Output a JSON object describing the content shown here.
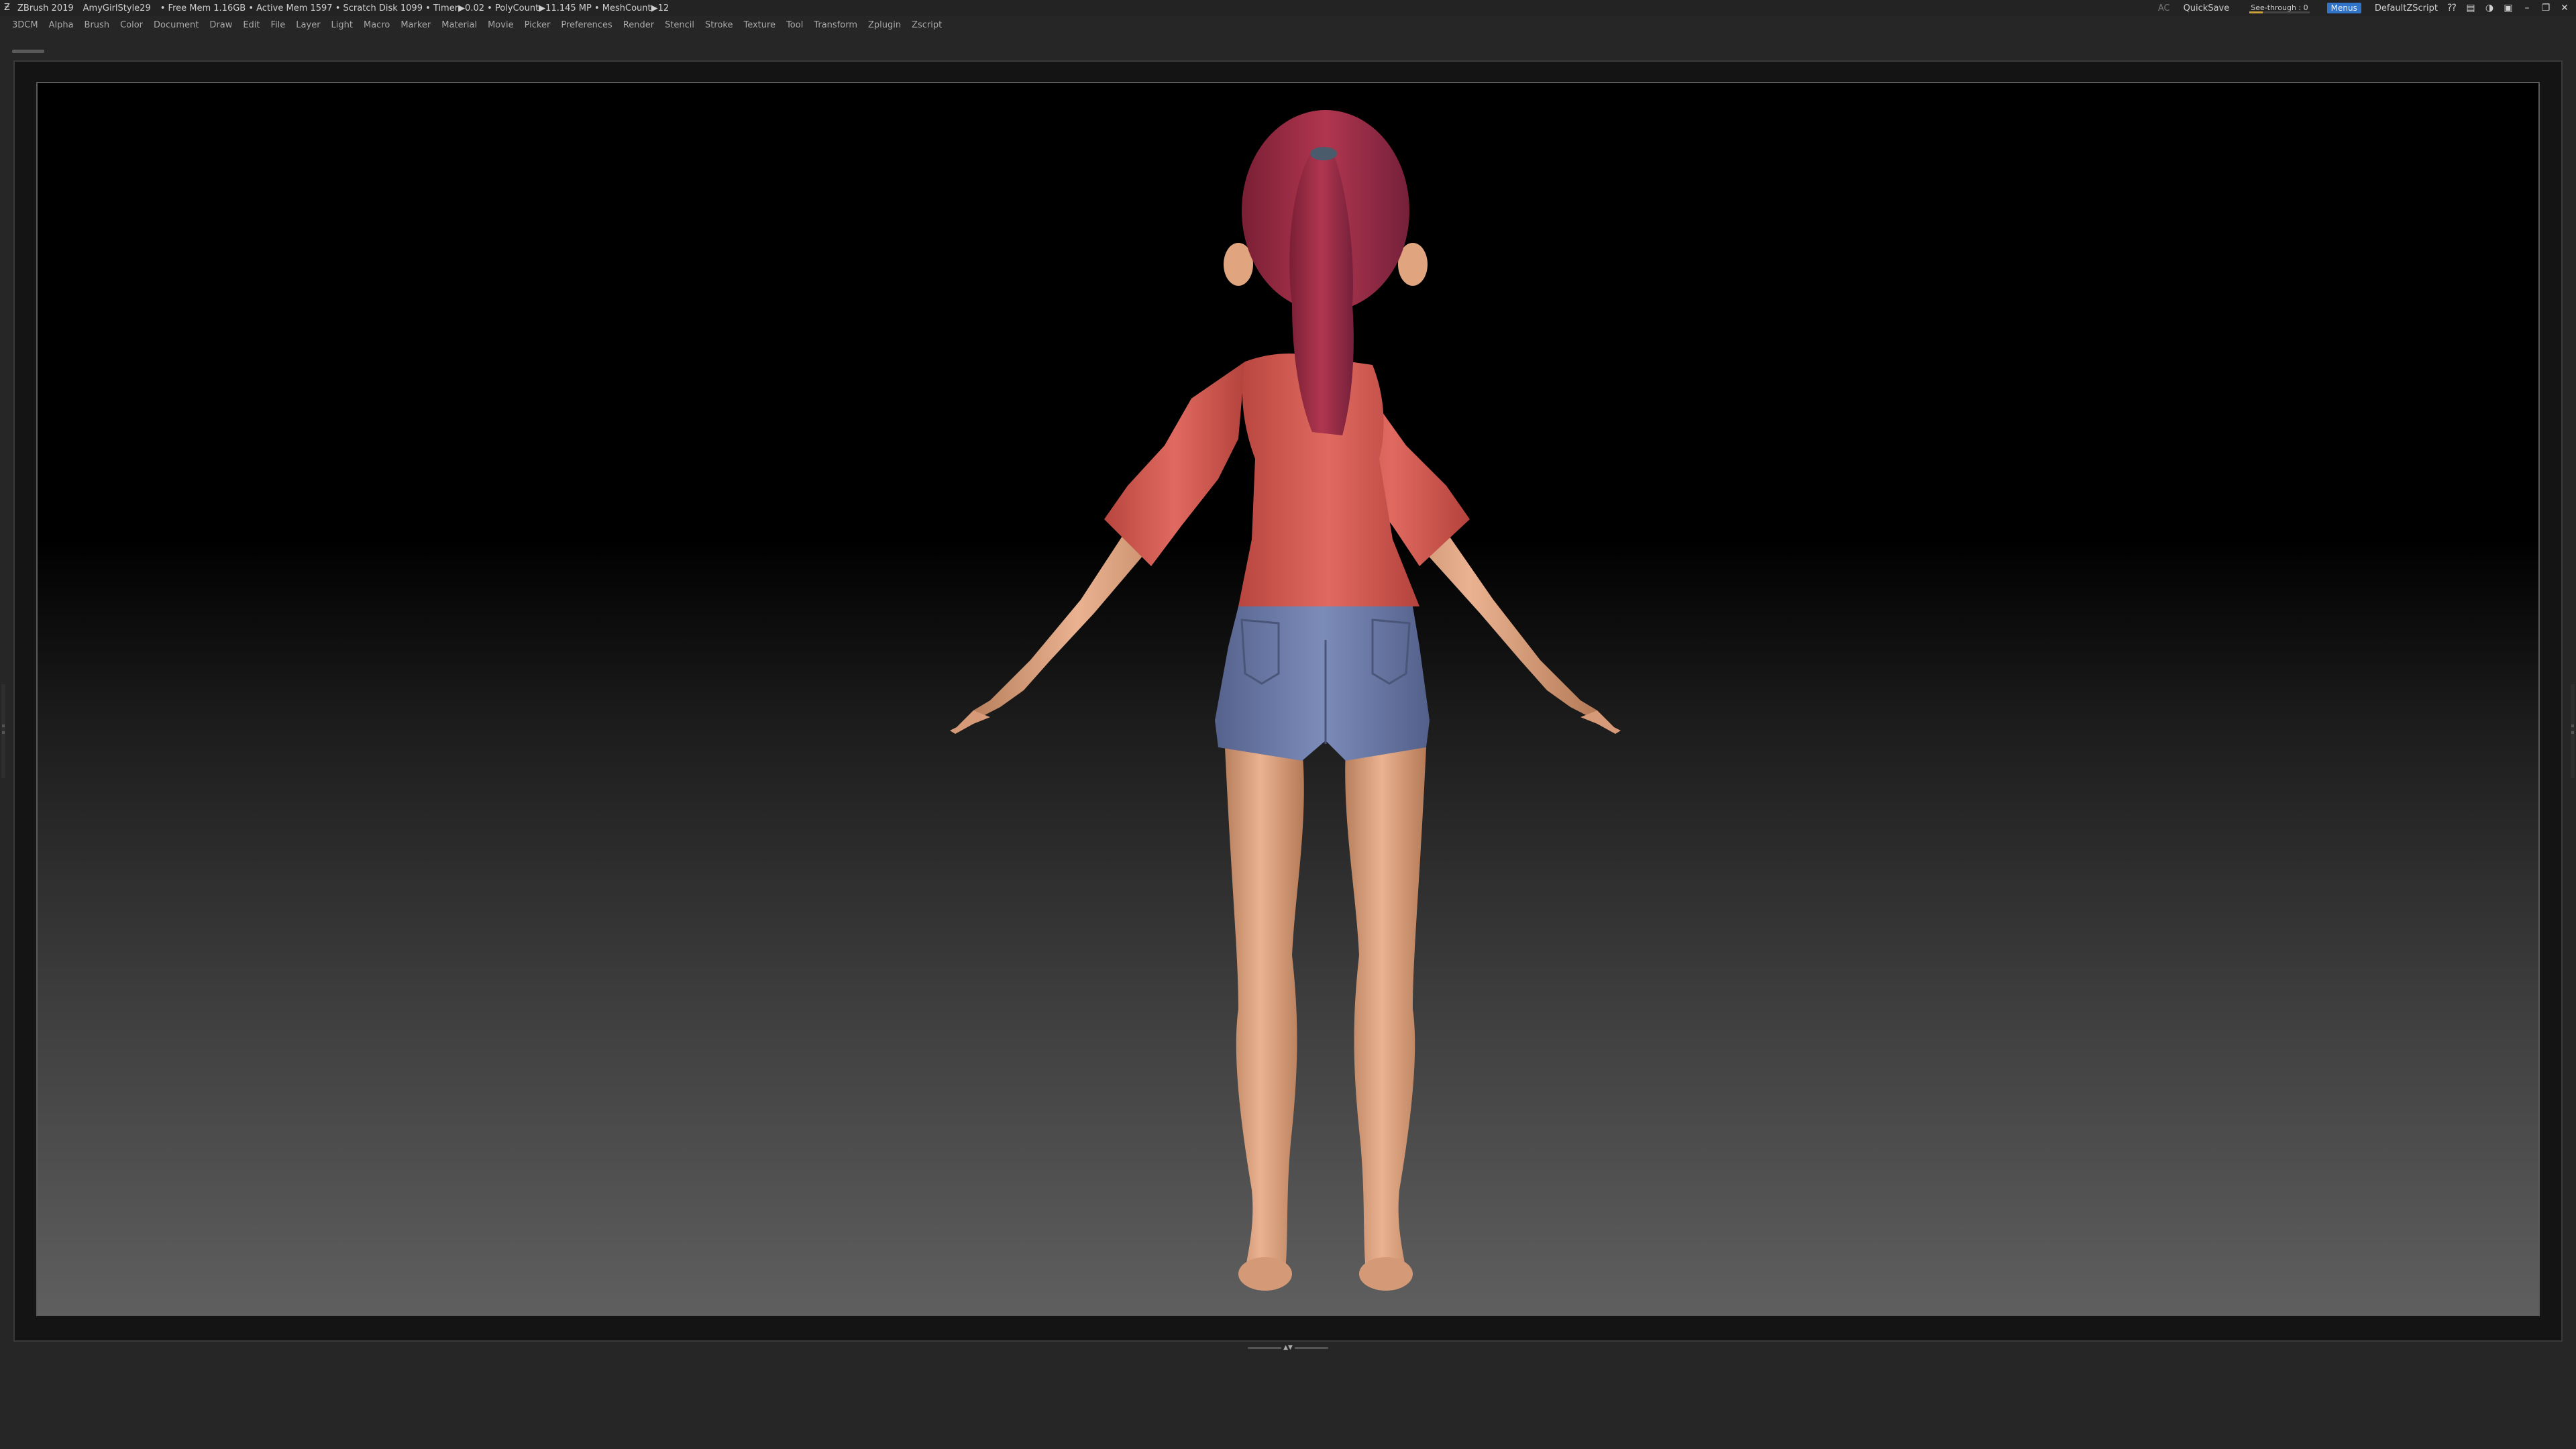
{
  "titlebar": {
    "app_name": "ZBrush 2019",
    "project": "AmyGirlStyle29",
    "stats": "• Free Mem 1.16GB • Active Mem 1597 • Scratch Disk 1099 • Timer▶0.02 • PolyCount▶11.145 MP • MeshCount▶12",
    "ac_label": "AC",
    "quicksave_label": "QuickSave",
    "see_through_label": "See-through",
    "see_through_value": "0",
    "see_through_fraction": 0,
    "menus_label": "Menus",
    "script_label": "DefaultZScript"
  },
  "menus": [
    "3DCM",
    "Alpha",
    "Brush",
    "Color",
    "Document",
    "Draw",
    "Edit",
    "File",
    "Layer",
    "Light",
    "Macro",
    "Marker",
    "Material",
    "Movie",
    "Picker",
    "Preferences",
    "Render",
    "Stencil",
    "Stroke",
    "Texture",
    "Tool",
    "Transform",
    "Zplugin",
    "Zscript"
  ],
  "icons": {
    "app_logo": "zbrush-logo-icon",
    "window_controls": [
      "help-icon",
      "layout-icon",
      "theme-icon",
      "lock-icon",
      "minimize-icon",
      "maximize-icon",
      "close-icon"
    ]
  },
  "colors": {
    "shirt": "#d4564f",
    "hair": "#9a2a44",
    "shorts": "#6a7aa8",
    "skin": "#e0a47e",
    "menus_highlight": "#2f74c9"
  }
}
